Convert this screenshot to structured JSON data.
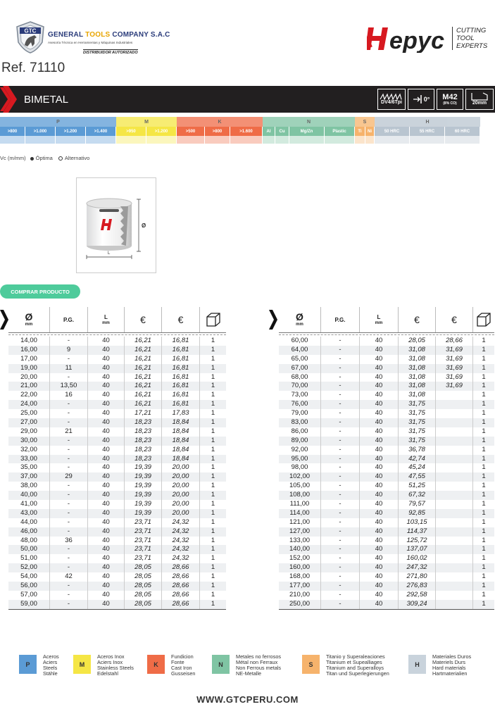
{
  "header": {
    "gtc_badge": "GTC",
    "company_name_a": "GENERAL",
    "company_name_b": "TOOLS",
    "company_name_c": "COMPANY S.A.C",
    "company_tagline": "Asesoría Técnica en Herramientas y Máquinas Industriales",
    "distributor": "DISTRIBUIDOR AUTORIZADO",
    "brand_tagline": [
      "CUTTING",
      "TOOL",
      "EXPERTS"
    ],
    "ref": "Ref. 71110"
  },
  "banner": {
    "title": "BIMETAL",
    "specs": [
      "DV4/6Tpi",
      "0°",
      "M42",
      "(8% CO)",
      "20mm"
    ]
  },
  "materials": {
    "groups": [
      {
        "letter": "P",
        "color": "#5b9bd5",
        "subs": [
          ">800",
          ">1.000",
          ">1.200",
          ">1.400"
        ]
      },
      {
        "letter": "M",
        "color": "#f5e645",
        "subs": [
          ">950",
          ">1.200"
        ]
      },
      {
        "letter": "K",
        "color": "#ef6c47",
        "subs": [
          ">500",
          ">800",
          ">1.600"
        ]
      },
      {
        "letter": "N",
        "color": "#7fc4a3",
        "subs": [
          "Al",
          "Cu",
          "Mg/Zn",
          "Plastic"
        ]
      },
      {
        "letter": "S",
        "color": "#f6b36c",
        "subs": [
          "Ti",
          "Ni"
        ]
      },
      {
        "letter": "H",
        "color": "#b9c5d0",
        "subs": [
          "50 HRC",
          "55 HRC",
          "60 HRC"
        ]
      }
    ]
  },
  "vc": {
    "label": "Vc (m/mm)",
    "optimal": "Óptima",
    "alternative": "Alternativo"
  },
  "product": {
    "dim_d": "Ø",
    "dim_l": "L"
  },
  "buy_button": "COMPRAR PRODUCTO",
  "table_headers": {
    "diameter": "Ø",
    "diameter_unit": "mm",
    "pg": "P.G.",
    "length": "L",
    "length_unit": "mm",
    "price": "€"
  },
  "table_left": [
    [
      "14,00",
      "-",
      "40",
      "16,21",
      "16,81",
      "1"
    ],
    [
      "16,00",
      "9",
      "40",
      "16,21",
      "16,81",
      "1"
    ],
    [
      "17,00",
      "-",
      "40",
      "16,21",
      "16,81",
      "1"
    ],
    [
      "19,00",
      "11",
      "40",
      "16,21",
      "16,81",
      "1"
    ],
    [
      "20,00",
      "-",
      "40",
      "16,21",
      "16,81",
      "1"
    ],
    [
      "21,00",
      "13,50",
      "40",
      "16,21",
      "16,81",
      "1"
    ],
    [
      "22,00",
      "16",
      "40",
      "16,21",
      "16,81",
      "1"
    ],
    [
      "24,00",
      "-",
      "40",
      "16,21",
      "16,81",
      "1"
    ],
    [
      "25,00",
      "-",
      "40",
      "17,21",
      "17,83",
      "1"
    ],
    [
      "27,00",
      "-",
      "40",
      "18,23",
      "18,84",
      "1"
    ],
    [
      "29,00",
      "21",
      "40",
      "18,23",
      "18,84",
      "1"
    ],
    [
      "30,00",
      "-",
      "40",
      "18,23",
      "18,84",
      "1"
    ],
    [
      "32,00",
      "-",
      "40",
      "18,23",
      "18,84",
      "1"
    ],
    [
      "33,00",
      "-",
      "40",
      "18,23",
      "18,84",
      "1"
    ],
    [
      "35,00",
      "-",
      "40",
      "19,39",
      "20,00",
      "1"
    ],
    [
      "37,00",
      "29",
      "40",
      "19,39",
      "20,00",
      "1"
    ],
    [
      "38,00",
      "-",
      "40",
      "19,39",
      "20,00",
      "1"
    ],
    [
      "40,00",
      "-",
      "40",
      "19,39",
      "20,00",
      "1"
    ],
    [
      "41,00",
      "-",
      "40",
      "19,39",
      "20,00",
      "1"
    ],
    [
      "43,00",
      "-",
      "40",
      "19,39",
      "20,00",
      "1"
    ],
    [
      "44,00",
      "-",
      "40",
      "23,71",
      "24,32",
      "1"
    ],
    [
      "46,00",
      "-",
      "40",
      "23,71",
      "24,32",
      "1"
    ],
    [
      "48,00",
      "36",
      "40",
      "23,71",
      "24,32",
      "1"
    ],
    [
      "50,00",
      "-",
      "40",
      "23,71",
      "24,32",
      "1"
    ],
    [
      "51,00",
      "-",
      "40",
      "23,71",
      "24,32",
      "1"
    ],
    [
      "52,00",
      "-",
      "40",
      "28,05",
      "28,66",
      "1"
    ],
    [
      "54,00",
      "42",
      "40",
      "28,05",
      "28,66",
      "1"
    ],
    [
      "56,00",
      "-",
      "40",
      "28,05",
      "28,66",
      "1"
    ],
    [
      "57,00",
      "-",
      "40",
      "28,05",
      "28,66",
      "1"
    ],
    [
      "59,00",
      "-",
      "40",
      "28,05",
      "28,66",
      "1"
    ]
  ],
  "table_right": [
    [
      "60,00",
      "-",
      "40",
      "28,05",
      "28,66",
      "1"
    ],
    [
      "64,00",
      "-",
      "40",
      "31,08",
      "31,69",
      "1"
    ],
    [
      "65,00",
      "-",
      "40",
      "31,08",
      "31,69",
      "1"
    ],
    [
      "67,00",
      "-",
      "40",
      "31,08",
      "31,69",
      "1"
    ],
    [
      "68,00",
      "-",
      "40",
      "31,08",
      "31,69",
      "1"
    ],
    [
      "70,00",
      "-",
      "40",
      "31,08",
      "31,69",
      "1"
    ],
    [
      "73,00",
      "-",
      "40",
      "31,08",
      "",
      "1"
    ],
    [
      "76,00",
      "-",
      "40",
      "31,75",
      "",
      "1"
    ],
    [
      "79,00",
      "-",
      "40",
      "31,75",
      "",
      "1"
    ],
    [
      "83,00",
      "-",
      "40",
      "31,75",
      "",
      "1"
    ],
    [
      "86,00",
      "-",
      "40",
      "31,75",
      "",
      "1"
    ],
    [
      "89,00",
      "-",
      "40",
      "31,75",
      "",
      "1"
    ],
    [
      "92,00",
      "-",
      "40",
      "36,78",
      "",
      "1"
    ],
    [
      "95,00",
      "-",
      "40",
      "42,74",
      "",
      "1"
    ],
    [
      "98,00",
      "-",
      "40",
      "45,24",
      "",
      "1"
    ],
    [
      "102,00",
      "-",
      "40",
      "47,55",
      "",
      "1"
    ],
    [
      "105,00",
      "-",
      "40",
      "51,25",
      "",
      "1"
    ],
    [
      "108,00",
      "-",
      "40",
      "67,32",
      "",
      "1"
    ],
    [
      "111,00",
      "-",
      "40",
      "79,57",
      "",
      "1"
    ],
    [
      "114,00",
      "-",
      "40",
      "92,85",
      "",
      "1"
    ],
    [
      "121,00",
      "-",
      "40",
      "103,15",
      "",
      "1"
    ],
    [
      "127,00",
      "-",
      "40",
      "114,37",
      "",
      "1"
    ],
    [
      "133,00",
      "-",
      "40",
      "125,72",
      "",
      "1"
    ],
    [
      "140,00",
      "-",
      "40",
      "137,07",
      "",
      "1"
    ],
    [
      "152,00",
      "-",
      "40",
      "160,02",
      "",
      "1"
    ],
    [
      "160,00",
      "-",
      "40",
      "247,32",
      "",
      "1"
    ],
    [
      "168,00",
      "-",
      "40",
      "271,80",
      "",
      "1"
    ],
    [
      "177,00",
      "-",
      "40",
      "276,83",
      "",
      "1"
    ],
    [
      "210,00",
      "-",
      "40",
      "292,58",
      "",
      "1"
    ],
    [
      "250,00",
      "-",
      "40",
      "309,24",
      "",
      "1"
    ]
  ],
  "legend": [
    {
      "letter": "P",
      "color": "#5b9bd5",
      "lines": "Aceros\nAciers\nSteels\nStähle"
    },
    {
      "letter": "M",
      "color": "#f5e645",
      "lines": "Aceros Inox\nAciers Inox\nStainless Steels\nEdelstahl"
    },
    {
      "letter": "K",
      "color": "#ef6c47",
      "lines": "Fundicion\nFonte\nCast Iron\nGusseisen"
    },
    {
      "letter": "N",
      "color": "#7fc4a3",
      "lines": "Metales no ferrosos\nMétal non Ferraux\nNon Ferrous metals\nNE-Metalle"
    },
    {
      "letter": "S",
      "color": "#f6b36c",
      "lines": "Titanio y Superaleaciones\nTitanium et Supealliages\nTitanium and Superalloys\nTitan und Superlegierungen"
    },
    {
      "letter": "H",
      "color": "#c9d3dc",
      "lines": "Materiales Duros\nMateriels Durs\nHard materials\nHartmaterialien"
    }
  ],
  "footer": "WWW.GTCPERU.COM",
  "colors": {
    "accent_red": "#d71920",
    "banner": "#221f20",
    "button": "#4ecb9b"
  }
}
